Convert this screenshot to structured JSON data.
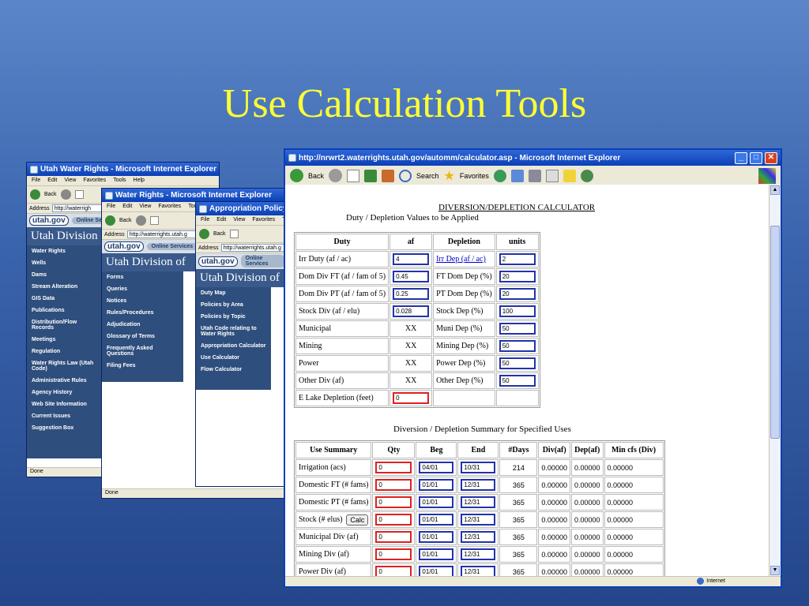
{
  "slide": {
    "title": "Use Calculation Tools"
  },
  "win1": {
    "title": "Utah Water Rights - Microsoft Internet Explorer",
    "menu": [
      "File",
      "Edit",
      "View",
      "Favorites",
      "Tools",
      "Help"
    ],
    "back": "Back",
    "address_label": "Address",
    "address": "http://waterrigh",
    "org": "Utah Division",
    "online_services": "Online Servic",
    "nav": [
      "Water Rights",
      "Wells",
      "Dams",
      "Stream Alteration",
      "GIS Data",
      "Publications",
      "Distribution/Flow Records",
      "Meetings",
      "Regulation",
      "Water Rights Law (Utah Code)",
      "Administrative Rules",
      "Agency History",
      "Web Site Information",
      "Current Issues",
      "Suggestion Box"
    ],
    "status": "Done"
  },
  "win2": {
    "title": "Water Rights - Microsoft Internet Explorer",
    "menu": [
      "File",
      "Edit",
      "View",
      "Favorites",
      "Tools",
      "Help"
    ],
    "back": "Back",
    "address_label": "Address",
    "address": "http://waterrights.utah.g",
    "org": "Utah Division of",
    "online_services": "Online Services",
    "nav": [
      "Forms",
      "Queries",
      "Notices",
      "Rules/Procedures",
      "Adjudication",
      "Glossary of Terms",
      "Frequently Asked Questions",
      "Filing Fees"
    ],
    "status": "Done"
  },
  "win3": {
    "title": "Appropriation Policy In",
    "menu": [
      "File",
      "Edit",
      "View",
      "Favorites",
      "Too"
    ],
    "back": "Back",
    "address_label": "Address",
    "address": "http://waterrights.utah.g",
    "org": "Utah Division of",
    "online_services": "Online Services",
    "nav": [
      "Duty Map",
      "Policies by Area",
      "Policies by Topic",
      "Utah Code relating to Water Rights",
      "Appropriation Calculator",
      "Use Calculator",
      "Flow Calculator"
    ]
  },
  "main": {
    "title": "http://nrwrt2.waterrights.utah.gov/automm/calculator.asp - Microsoft Internet Explorer",
    "toolbar": {
      "back": "Back",
      "search": "Search",
      "favorites": "Favorites"
    },
    "status": "Internet",
    "calc_title": "DIVERSION/DEPLETION CALCULATOR",
    "duty_subtitle": "Duty / Depletion Values to be Applied",
    "duty_headers": [
      "Duty",
      "af",
      "Depletion",
      "units"
    ],
    "duty_rows": [
      {
        "duty": "Irr Duty (af / ac)",
        "af": "4",
        "af_type": "input",
        "depletion": "Irr Dep (af / ac)",
        "dep_link": true,
        "units": "2"
      },
      {
        "duty": "Dom Div FT (af / fam of 5)",
        "af": "0.45",
        "af_type": "input",
        "depletion": "FT Dom Dep (%)",
        "units": "20"
      },
      {
        "duty": "Dom Div PT (af / fam of 5)",
        "af": "0.25",
        "af_type": "input",
        "depletion": "PT Dom Dep (%)",
        "units": "20"
      },
      {
        "duty": "Stock Div (af / elu)",
        "af": "0.028",
        "af_type": "input",
        "depletion": "Stock Dep (%)",
        "units": "100"
      },
      {
        "duty": "Municipal",
        "af": "XX",
        "af_type": "text",
        "depletion": "Muni Dep (%)",
        "units": "50"
      },
      {
        "duty": "Mining",
        "af": "XX",
        "af_type": "text",
        "depletion": "Mining Dep (%)",
        "units": "50"
      },
      {
        "duty": "Power",
        "af": "XX",
        "af_type": "text",
        "depletion": "Power Dep (%)",
        "units": "50"
      },
      {
        "duty": "Other Div (af)",
        "af": "XX",
        "af_type": "text",
        "depletion": "Other Dep (%)",
        "units": "50"
      },
      {
        "duty": "E Lake Depletion (feet)",
        "af": "0",
        "af_type": "red",
        "depletion": "",
        "units": ""
      }
    ],
    "summary_subtitle": "Diversion / Depletion Summary for Specified Uses",
    "summary_headers": [
      "Use Summary",
      "Qty",
      "Beg",
      "End",
      "#Days",
      "Div(af)",
      "Dep(af)",
      "Min cfs (Div)"
    ],
    "summary_rows": [
      {
        "use": "Irrigation (acs)",
        "qty": "0",
        "beg": "04/01",
        "end": "10/31",
        "days": "214",
        "div": "0.00000",
        "dep": "0.00000",
        "cfs": "0.00000"
      },
      {
        "use": "Domestic FT (# fams)",
        "qty": "0",
        "beg": "01/01",
        "end": "12/31",
        "days": "365",
        "div": "0.00000",
        "dep": "0.00000",
        "cfs": "0.00000"
      },
      {
        "use": "Domestic PT (# fams)",
        "qty": "0",
        "beg": "01/01",
        "end": "12/31",
        "days": "365",
        "div": "0.00000",
        "dep": "0.00000",
        "cfs": "0.00000"
      },
      {
        "use": "Stock (# elus)",
        "qty": "0",
        "beg": "01/01",
        "end": "12/31",
        "days": "365",
        "div": "0.00000",
        "dep": "0.00000",
        "cfs": "0.00000"
      },
      {
        "use": "Municipal Div (af)",
        "qty": "0",
        "beg": "01/01",
        "end": "12/31",
        "days": "365",
        "div": "0.00000",
        "dep": "0.00000",
        "cfs": "0.00000"
      },
      {
        "use": "Mining Div (af)",
        "qty": "0",
        "beg": "01/01",
        "end": "12/31",
        "days": "365",
        "div": "0.00000",
        "dep": "0.00000",
        "cfs": "0.00000"
      },
      {
        "use": "Power Div (af)",
        "qty": "0",
        "beg": "01/01",
        "end": "12/31",
        "days": "365",
        "div": "0.00000",
        "dep": "0.00000",
        "cfs": "0.00000"
      }
    ],
    "calc_button": "Calc"
  }
}
